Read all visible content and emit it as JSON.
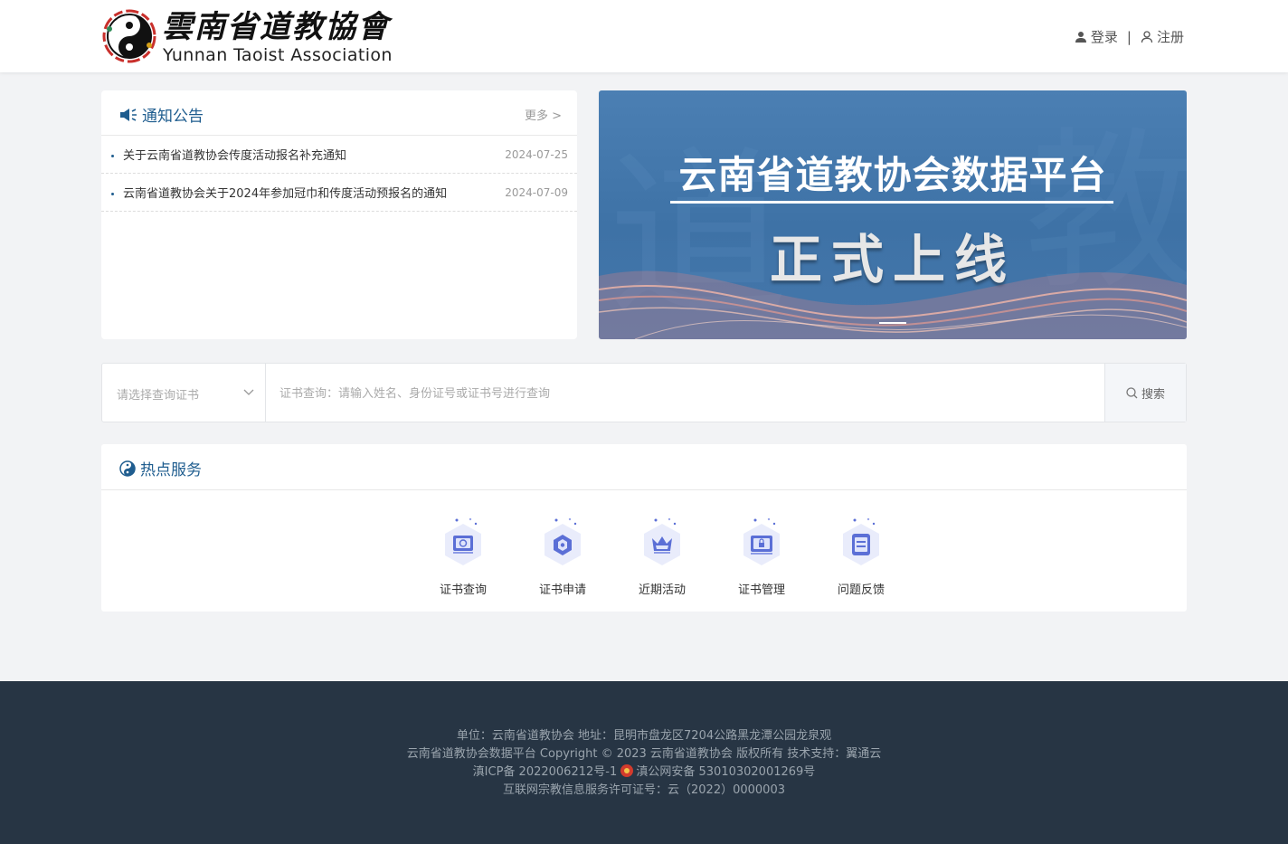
{
  "header": {
    "logo_cn": "雲南省道教協會",
    "logo_en": "Yunnan Taoist Association",
    "login_label": "登录",
    "separator": "|",
    "register_label": "注册"
  },
  "notice": {
    "title": "通知公告",
    "more_label": "更多 >",
    "items": [
      {
        "title": "关于云南省道教协会传度活动报名补充通知",
        "date": "2024-07-25"
      },
      {
        "title": "云南省道教协会关于2024年参加冠巾和传度活动预报名的通知",
        "date": "2024-07-09"
      }
    ]
  },
  "banner": {
    "title": "云南省道教协会数据平台",
    "subtitle": "正式上线"
  },
  "search": {
    "select_placeholder": "请选择查询证书",
    "input_placeholder": "证书查询：请输入姓名、身份证号或证书号进行查询",
    "button_label": "搜索"
  },
  "hot": {
    "title": "热点服务",
    "services": [
      {
        "label": "证书查询",
        "icon": "certificate-query-icon"
      },
      {
        "label": "证书申请",
        "icon": "certificate-apply-icon"
      },
      {
        "label": "近期活动",
        "icon": "crown-icon"
      },
      {
        "label": "证书管理",
        "icon": "lock-screen-icon"
      },
      {
        "label": "问题反馈",
        "icon": "feedback-icon"
      }
    ]
  },
  "footer": {
    "line1": "单位：云南省道教协会 地址：昆明市盘龙区7204公路黑龙潭公园龙泉观",
    "line2": "云南省道教协会数据平台 Copyright © 2023 云南省道教协会 版权所有 技术支持：翼通云",
    "icp": "滇ICP备 2022006212号-1",
    "police": "滇公网安备 53010302001269号",
    "line4": "互联网宗教信息服务许可证号：云（2022）0000003"
  },
  "colors": {
    "brand_blue": "#1f5d8f",
    "banner_blue": "#4177ab",
    "footer_bg": "#273544",
    "icon_accent": "#5b6fd6"
  }
}
